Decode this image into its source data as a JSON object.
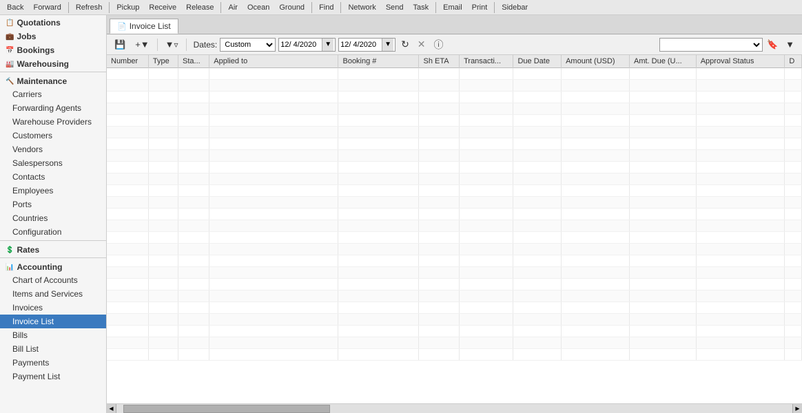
{
  "toolbar": {
    "buttons": [
      {
        "label": "Back",
        "name": "back-button"
      },
      {
        "label": "Forward",
        "name": "forward-button"
      },
      {
        "label": "Refresh",
        "name": "refresh-button"
      },
      {
        "label": "Pickup",
        "name": "pickup-button"
      },
      {
        "label": "Receive",
        "name": "receive-button"
      },
      {
        "label": "Release",
        "name": "release-button"
      },
      {
        "label": "Air",
        "name": "air-button"
      },
      {
        "label": "Ocean",
        "name": "ocean-button"
      },
      {
        "label": "Ground",
        "name": "ground-button"
      },
      {
        "label": "Find",
        "name": "find-button"
      },
      {
        "label": "Network",
        "name": "network-button"
      },
      {
        "label": "Send",
        "name": "send-button"
      },
      {
        "label": "Task",
        "name": "task-button"
      },
      {
        "label": "Email",
        "name": "email-button"
      },
      {
        "label": "Print",
        "name": "print-button"
      },
      {
        "label": "Sidebar",
        "name": "sidebar-button"
      }
    ]
  },
  "sidebar": {
    "sections": [
      {
        "name": "quotations",
        "label": "Quotations",
        "icon": "📋",
        "items": []
      },
      {
        "name": "jobs",
        "label": "Jobs",
        "icon": "💼",
        "items": []
      },
      {
        "name": "bookings",
        "label": "Bookings",
        "icon": "📅",
        "items": []
      },
      {
        "name": "warehousing",
        "label": "Warehousing",
        "icon": "🏭",
        "items": []
      },
      {
        "name": "maintenance",
        "label": "Maintenance",
        "icon": "🔧",
        "items": [
          {
            "label": "Carriers",
            "name": "carriers"
          },
          {
            "label": "Forwarding Agents",
            "name": "forwarding-agents"
          },
          {
            "label": "Warehouse Providers",
            "name": "warehouse-providers"
          },
          {
            "label": "Customers",
            "name": "customers"
          },
          {
            "label": "Vendors",
            "name": "vendors"
          },
          {
            "label": "Salespersons",
            "name": "salespersons"
          },
          {
            "label": "Contacts",
            "name": "contacts"
          },
          {
            "label": "Employees",
            "name": "employees"
          },
          {
            "label": "Ports",
            "name": "ports"
          },
          {
            "label": "Countries",
            "name": "countries"
          },
          {
            "label": "Configuration",
            "name": "configuration"
          }
        ]
      },
      {
        "name": "rates",
        "label": "Rates",
        "icon": "💲",
        "items": []
      },
      {
        "name": "accounting",
        "label": "Accounting",
        "icon": "📊",
        "items": [
          {
            "label": "Chart of Accounts",
            "name": "chart-of-accounts"
          },
          {
            "label": "Items and Services",
            "name": "items-and-services"
          },
          {
            "label": "Invoices",
            "name": "invoices"
          },
          {
            "label": "Invoice List",
            "name": "invoice-list",
            "active": true
          },
          {
            "label": "Bills",
            "name": "bills"
          },
          {
            "label": "Bill List",
            "name": "bill-list"
          },
          {
            "label": "Payments",
            "name": "payments"
          },
          {
            "label": "Payment List",
            "name": "payment-list"
          }
        ]
      }
    ]
  },
  "tabs": [
    {
      "label": "Invoice List",
      "name": "invoice-list-tab",
      "icon": "📄",
      "active": true
    }
  ],
  "action_bar": {
    "dates_label": "Dates:",
    "dates_select_value": "Custom",
    "date_from": "12/ 4/2020",
    "date_to": "12/ 4/2020",
    "search_placeholder": ""
  },
  "table": {
    "columns": [
      {
        "label": "Number",
        "name": "col-number"
      },
      {
        "label": "Type",
        "name": "col-type"
      },
      {
        "label": "Sta...",
        "name": "col-status"
      },
      {
        "label": "Applied to",
        "name": "col-applied-to"
      },
      {
        "label": "Booking #",
        "name": "col-booking"
      },
      {
        "label": "Sh ETA",
        "name": "col-sh-eta"
      },
      {
        "label": "Transacti...",
        "name": "col-transaction"
      },
      {
        "label": "Due Date",
        "name": "col-due-date"
      },
      {
        "label": "Amount (USD)",
        "name": "col-amount"
      },
      {
        "label": "Amt. Due (U...",
        "name": "col-amt-due"
      },
      {
        "label": "Approval Status",
        "name": "col-approval-status"
      },
      {
        "label": "D",
        "name": "col-d"
      }
    ],
    "rows": []
  }
}
